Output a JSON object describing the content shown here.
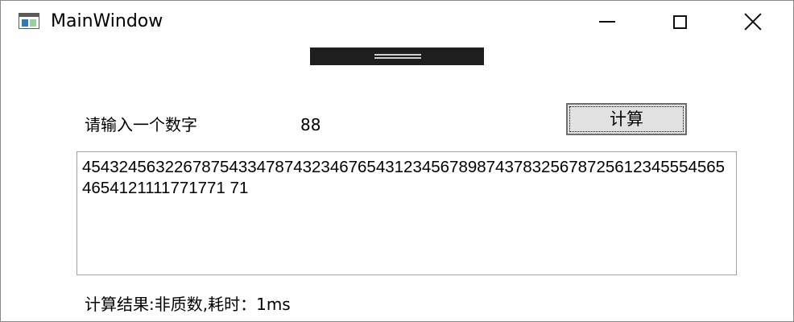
{
  "window": {
    "title": "MainWindow",
    "icon": "app-window-icon",
    "controls": {
      "minimize_icon": "minimize-icon",
      "maximize_icon": "maximize-icon",
      "close_icon": "close-icon"
    }
  },
  "form": {
    "prompt_label": "请输入一个数字",
    "number_value": "88",
    "calculate_button": "计算",
    "big_number": "45432456322678754334787432346765431234567898743783256787256123455545654654121111771771 71"
  },
  "result": {
    "text": "计算结果:非质数,耗时：1ms"
  }
}
